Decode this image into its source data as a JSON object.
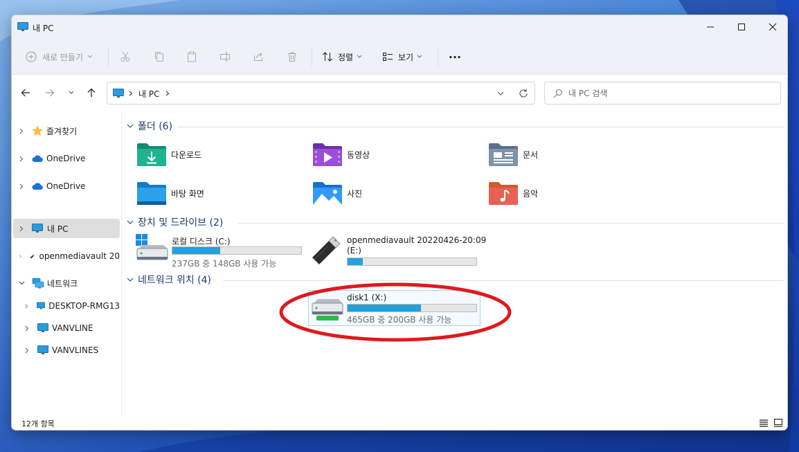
{
  "window": {
    "title": "내 PC"
  },
  "toolbar": {
    "new_label": "새로 만들기",
    "sort_label": "정렬",
    "view_label": "보기",
    "more_label": "···"
  },
  "navigation": {
    "breadcrumb": [
      "내 PC"
    ],
    "search_placeholder": "내 PC 검색"
  },
  "sidebar": {
    "items": [
      {
        "label": "즐겨찾기",
        "icon": "star-icon"
      },
      {
        "label": "OneDrive",
        "icon": "cloud-icon"
      },
      {
        "label": "OneDrive",
        "icon": "cloud-icon"
      },
      {
        "label": "내 PC",
        "icon": "monitor-icon",
        "selected": true
      },
      {
        "label": "openmediavault 20",
        "icon": "usb-drive-icon"
      },
      {
        "label": "네트워크",
        "icon": "network-icon"
      },
      {
        "label": "DESKTOP-RMG13",
        "icon": "monitor-icon"
      },
      {
        "label": "VANVLINE",
        "icon": "monitor-icon"
      },
      {
        "label": "VANVLINES",
        "icon": "monitor-icon"
      }
    ]
  },
  "sections": {
    "folders": {
      "title": "폴더 (6)",
      "items": [
        {
          "label": "다운로드",
          "icon": "downloads-folder-icon"
        },
        {
          "label": "동영상",
          "icon": "videos-folder-icon"
        },
        {
          "label": "문서",
          "icon": "documents-folder-icon"
        },
        {
          "label": "바탕 화면",
          "icon": "desktop-folder-icon"
        },
        {
          "label": "사진",
          "icon": "pictures-folder-icon"
        },
        {
          "label": "음악",
          "icon": "music-folder-icon"
        }
      ]
    },
    "drives": {
      "title": "장치 및 드라이브 (2)",
      "items": [
        {
          "name": "로컬 디스크 (C:)",
          "free_text": "237GB 중 148GB 사용 가능",
          "used_fraction": 0.37
        },
        {
          "name": "openmediavault 20220426-20:09",
          "name_line2": "(E:)",
          "used_fraction": 0.12
        }
      ]
    },
    "network_locations": {
      "title": "네트워크 위치 (4)",
      "items": [
        {
          "name": "disk1 (X:)",
          "free_text": "465GB 중 200GB 사용 가능",
          "used_fraction": 0.57
        }
      ]
    }
  },
  "status": {
    "item_count": "12개 항목"
  },
  "colors": {
    "accent": "#26a0da",
    "annotation": "#e0191e",
    "window_chrome": "#eef2f8"
  }
}
